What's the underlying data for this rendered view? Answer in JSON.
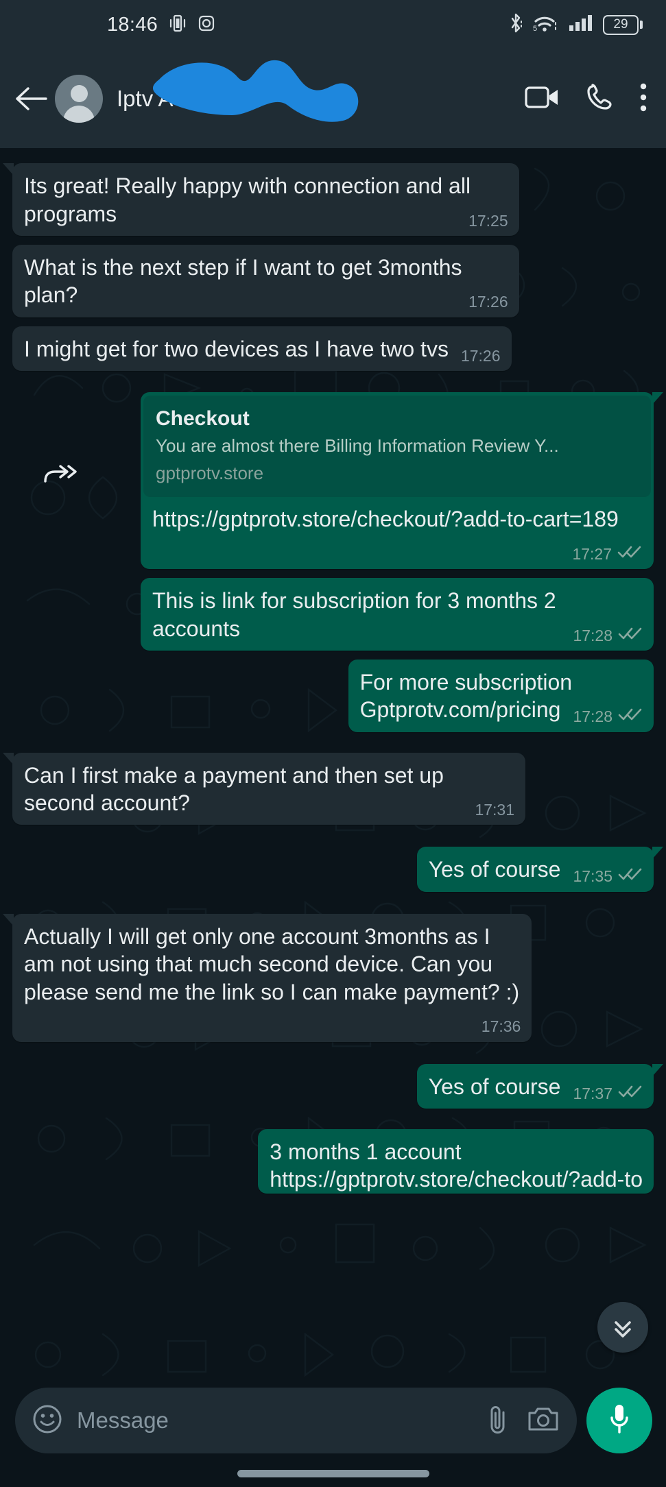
{
  "status_bar": {
    "time": "18:46",
    "battery_percent": "29",
    "icons": [
      "vibrate-icon",
      "instagram-icon",
      "bluetooth-icon",
      "wifi-icon",
      "cellular-signal-icon",
      "battery-icon"
    ]
  },
  "header": {
    "contact_name": "Iptv A",
    "back_label": "back-arrow",
    "actions": [
      "video-call",
      "voice-call",
      "overflow-menu"
    ],
    "redacted": true,
    "redaction_color": "#1e87dd"
  },
  "chat": {
    "messages": [
      {
        "id": "m1",
        "direction": "in",
        "tail": true,
        "text": "Its great! Really happy with connection and all programs",
        "time": "17:25",
        "status": "none"
      },
      {
        "id": "m2",
        "direction": "in",
        "tail": false,
        "text": "What is the next step if I want to get 3months plan?",
        "time": "17:26",
        "status": "none"
      },
      {
        "id": "m3",
        "direction": "in",
        "tail": false,
        "text": "I might get for two devices as I have two tvs",
        "time": "17:26",
        "status": "none"
      },
      {
        "id": "m4",
        "direction": "out",
        "tail": true,
        "forwarded": true,
        "preview": {
          "title": "Checkout",
          "description": "You are almost there Billing Information Review Y...",
          "host": "gptprotv.store"
        },
        "link_text": "https://gptprotv.store/checkout/?add-to-cart=189",
        "time": "17:27",
        "status": "delivered"
      },
      {
        "id": "m5",
        "direction": "out",
        "tail": false,
        "text": "This is link for subscription for 3 months 2 accounts",
        "time": "17:28",
        "status": "delivered"
      },
      {
        "id": "m6",
        "direction": "out",
        "tail": false,
        "text": "For more subscription",
        "link_text": "Gptprotv.com/pricing",
        "time": "17:28",
        "status": "delivered"
      },
      {
        "id": "m7",
        "direction": "in",
        "tail": true,
        "text": "Can I first make a payment and then set up second account?",
        "time": "17:31",
        "status": "none"
      },
      {
        "id": "m8",
        "direction": "out",
        "tail": true,
        "text": "Yes of course",
        "time": "17:35",
        "status": "delivered"
      },
      {
        "id": "m9",
        "direction": "in",
        "tail": true,
        "text": "Actually I will get only one account 3months as I am not using that much second device. Can you please send me the link so I can make payment? :)",
        "time": "17:36",
        "status": "none"
      },
      {
        "id": "m10",
        "direction": "out",
        "tail": true,
        "text": "Yes of course",
        "time": "17:37",
        "status": "delivered"
      },
      {
        "id": "m11",
        "direction": "out",
        "tail": false,
        "text": "3 months 1 account",
        "link_text": "https://gptprotv.store/checkout/?add-to",
        "time": "",
        "status": "none",
        "clipped": true
      }
    ],
    "scroll_down_button": "scroll-to-bottom"
  },
  "input_bar": {
    "placeholder": "Message",
    "emoji_icon": "emoji-icon",
    "attach_icon": "paperclip-icon",
    "camera_icon": "camera-icon",
    "mic_icon": "microphone-icon"
  },
  "colors": {
    "outgoing_bubble": "#005c4b",
    "incoming_bubble": "#202c33",
    "chat_background": "#0b141a",
    "header_background": "#1f2c34",
    "link": "#53bdeb",
    "accent": "#00a884"
  }
}
